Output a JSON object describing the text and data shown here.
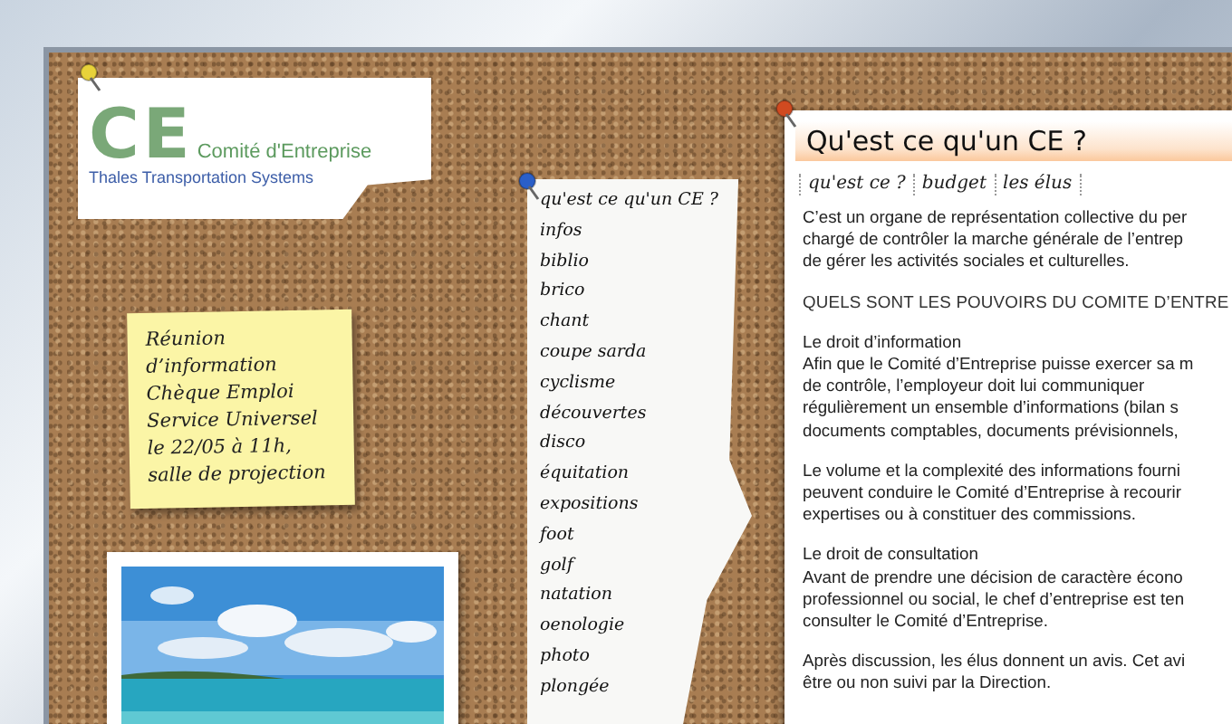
{
  "logo": {
    "mark": "CE",
    "name": "Comité d'Entreprise",
    "subtitle": "Thales Transportation Systems"
  },
  "note": {
    "lines": [
      "Réunion",
      "d’information",
      "Chèque Emploi",
      "Service Universel",
      "le 22/05 à 11h,",
      "salle de projection"
    ]
  },
  "menu": {
    "items": [
      "qu'est ce qu'un CE ?",
      "infos",
      "biblio",
      "brico",
      "chant",
      "coupe sarda",
      "cyclisme",
      "découvertes",
      "disco",
      "équitation",
      "expositions",
      "foot",
      "golf",
      "natation",
      "oenologie",
      "photo",
      "plongée"
    ]
  },
  "article": {
    "title": "Qu'est ce qu'un CE ?",
    "tabs": [
      "qu'est ce ?",
      "budget",
      "les élus"
    ],
    "blocks": [
      {
        "kind": "paragraph",
        "lines": [
          "C’est un organe de représentation collective du per",
          "chargé de contrôler la marche générale de l’entrep",
          "de gérer les activités sociales et culturelles."
        ]
      },
      {
        "kind": "heading",
        "lines": [
          "QUELS SONT LES POUVOIRS DU COMITE D’ENTRE"
        ]
      },
      {
        "kind": "paragraph",
        "lines": [
          "Le droit d’information",
          "Afin que le Comité d’Entreprise puisse exercer sa m",
          "de contrôle, l’employeur doit lui communiquer",
          "régulièrement un ensemble d’informations (bilan s",
          "documents comptables, documents prévisionnels,"
        ]
      },
      {
        "kind": "paragraph",
        "lines": [
          "Le volume et la complexité des informations fourni",
          "peuvent conduire le Comité d’Entreprise à recourir",
          "expertises ou à constituer des commissions."
        ]
      },
      {
        "kind": "paragraph",
        "lines": [
          "Le droit de consultation",
          "Avant de prendre une décision de caractère écono",
          "professionnel ou social, le chef d’entreprise est ten",
          "consulter le Comité d’Entreprise."
        ]
      },
      {
        "kind": "paragraph",
        "lines": [
          "Après discussion, les élus donnent un avis. Cet avi",
          "être ou non suivi par la Direction."
        ]
      }
    ]
  }
}
